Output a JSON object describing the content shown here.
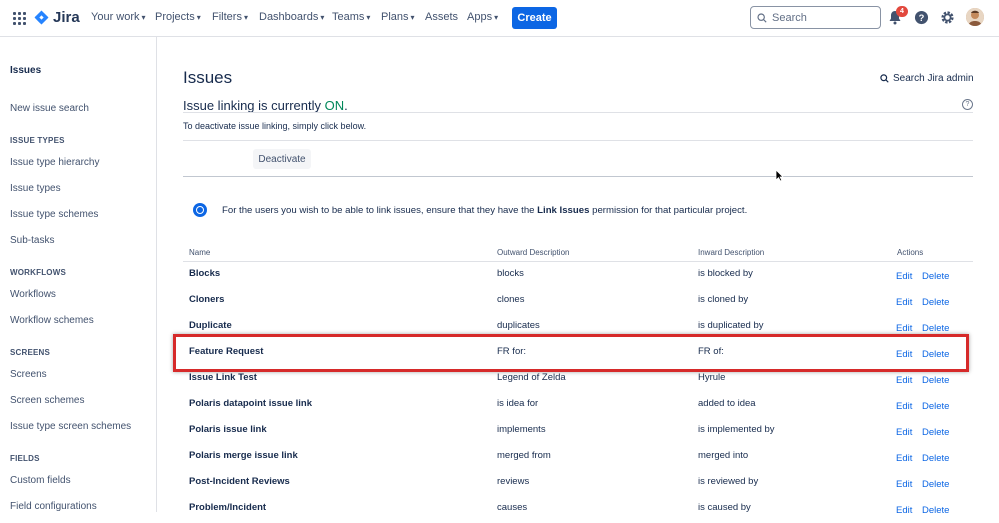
{
  "topnav": {
    "logo": "Jira",
    "items": [
      "Your work",
      "Projects",
      "Filters",
      "Dashboards",
      "Teams",
      "Plans",
      "Assets",
      "Apps"
    ],
    "create_label": "Create",
    "search_placeholder": "Search",
    "notification_count": "4",
    "accent": "#0c66e4"
  },
  "sidebar": {
    "title": "Issues",
    "new_issue_search": "New issue search",
    "sections": {
      "issue_types": {
        "heading": "ISSUE TYPES",
        "links": [
          "Issue type hierarchy",
          "Issue types",
          "Issue type schemes",
          "Sub-tasks"
        ]
      },
      "workflows": {
        "heading": "WORKFLOWS",
        "links": [
          "Workflows",
          "Workflow schemes"
        ]
      },
      "screens": {
        "heading": "SCREENS",
        "links": [
          "Screens",
          "Screen schemes",
          "Issue type screen schemes"
        ]
      },
      "fields": {
        "heading": "FIELDS",
        "links": [
          "Custom fields",
          "Field configurations"
        ]
      }
    }
  },
  "main": {
    "title": "Issues",
    "admin_search": "Search Jira admin",
    "linking_prefix": "Issue linking is currently ",
    "linking_state": "ON",
    "linking_suffix": ".",
    "deactivate_text": "To deactivate issue linking, simply click below.",
    "deactivate_label": "Deactivate",
    "info_pre": "For the users you wish to be able to link issues, ensure that they have the ",
    "info_bold": "Link Issues",
    "info_post": " permission for that particular project."
  },
  "table": {
    "headers": {
      "name": "Name",
      "outward": "Outward Description",
      "inward": "Inward Description",
      "actions": "Actions"
    },
    "edit_label": "Edit",
    "delete_label": "Delete",
    "rows": [
      {
        "name": "Blocks",
        "outward": "blocks",
        "inward": "is blocked by"
      },
      {
        "name": "Cloners",
        "outward": "clones",
        "inward": "is cloned by"
      },
      {
        "name": "Duplicate",
        "outward": "duplicates",
        "inward": "is duplicated by"
      },
      {
        "name": "Feature Request",
        "outward": "FR for:",
        "inward": "FR of:"
      },
      {
        "name": "Issue Link Test",
        "outward": "Legend of Zelda",
        "inward": "Hyrule"
      },
      {
        "name": "Polaris datapoint issue link",
        "outward": "is idea for",
        "inward": "added to idea"
      },
      {
        "name": "Polaris issue link",
        "outward": "implements",
        "inward": "is implemented by"
      },
      {
        "name": "Polaris merge issue link",
        "outward": "merged from",
        "inward": "merged into"
      },
      {
        "name": "Post-Incident Reviews",
        "outward": "reviews",
        "inward": "is reviewed by"
      },
      {
        "name": "Problem/Incident",
        "outward": "causes",
        "inward": "is caused by"
      }
    ]
  }
}
